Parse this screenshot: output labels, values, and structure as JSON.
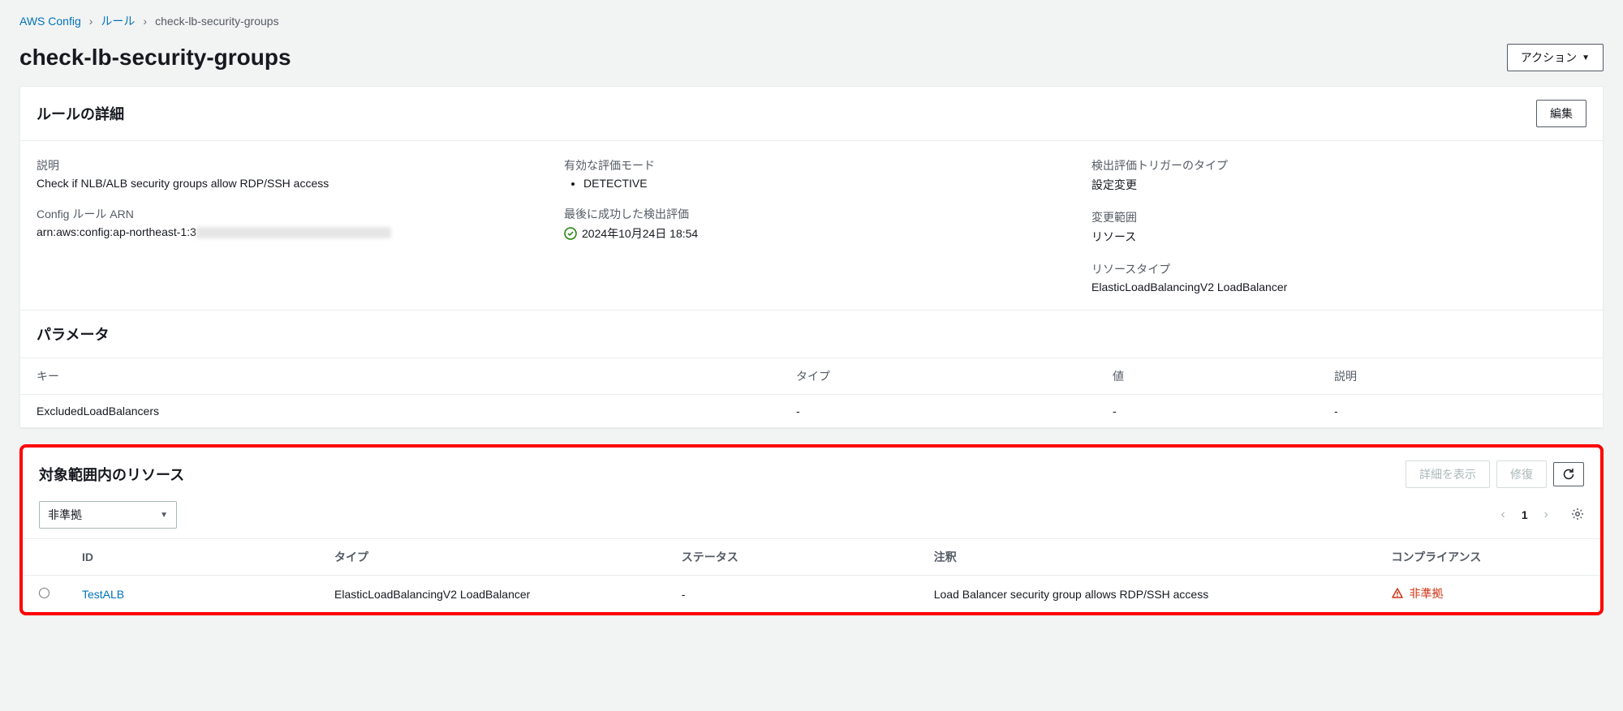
{
  "breadcrumb": {
    "root": "AWS Config",
    "parent": "ルール",
    "current": "check-lb-security-groups"
  },
  "page_title": "check-lb-security-groups",
  "actions_button": "アクション",
  "rule_details": {
    "panel_title": "ルールの詳細",
    "edit_button": "編集",
    "fields": {
      "description_label": "説明",
      "description_value": "Check if NLB/ALB security groups allow RDP/SSH access",
      "arn_label": "Config ルール ARN",
      "arn_prefix": "arn:aws:config:ap-northeast-1:3",
      "eval_mode_label": "有効な評価モード",
      "eval_mode_value": "DETECTIVE",
      "last_eval_label": "最後に成功した検出評価",
      "last_eval_value": "2024年10月24日 18:54",
      "trigger_label": "検出評価トリガーのタイプ",
      "trigger_value": "設定変更",
      "scope_label": "変更範囲",
      "scope_value": "リソース",
      "restype_label": "リソースタイプ",
      "restype_value": "ElasticLoadBalancingV2 LoadBalancer"
    }
  },
  "parameters": {
    "title": "パラメータ",
    "headers": {
      "key": "キー",
      "type": "タイプ",
      "value": "値",
      "description": "説明"
    },
    "rows": [
      {
        "key": "ExcludedLoadBalancers",
        "type": "-",
        "value": "-",
        "description": "-"
      }
    ]
  },
  "resources": {
    "title": "対象範囲内のリソース",
    "view_details_btn": "詳細を表示",
    "remediate_btn": "修復",
    "filter_selected": "非準拠",
    "page_number": "1",
    "headers": {
      "id": "ID",
      "type": "タイプ",
      "status": "ステータス",
      "annotation": "注釈",
      "compliance": "コンプライアンス"
    },
    "rows": [
      {
        "id": "TestALB",
        "type": "ElasticLoadBalancingV2 LoadBalancer",
        "status": "-",
        "annotation": "Load Balancer security group allows RDP/SSH access",
        "compliance": "非準拠"
      }
    ]
  }
}
